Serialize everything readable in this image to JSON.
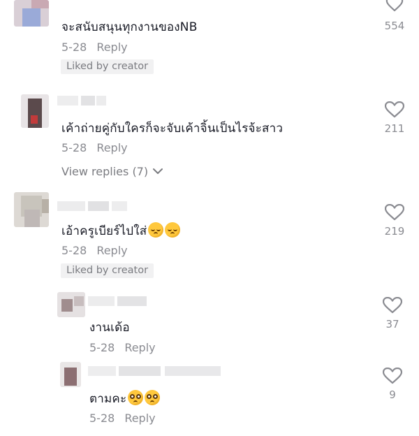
{
  "comments": [
    {
      "text": "จะสนับสนุนทุกงานของNB",
      "date": "5-28",
      "reply_label": "Reply",
      "liked_badge": "Liked by creator",
      "likes": "554"
    },
    {
      "text": "เค้าถ่ายคู่กับใครก็จะจับเค้าจิ้นเป็นไรจ้ะสาว",
      "date": "5-28",
      "reply_label": "Reply",
      "view_replies": "View replies (7)",
      "likes": "211"
    },
    {
      "text": "เอ้าครูเบียร์ไปใส่",
      "emojis": [
        "relieved-face-emoji",
        "relieved-face-emoji"
      ],
      "date": "5-28",
      "reply_label": "Reply",
      "liked_badge": "Liked by creator",
      "likes": "219"
    },
    {
      "text": "งานเด้อ",
      "date": "5-28",
      "reply_label": "Reply",
      "likes": "37"
    },
    {
      "text": "ตามคะ",
      "emojis": [
        "pleading-face-emoji",
        "pleading-face-emoji"
      ],
      "date": "5-28",
      "reply_label": "Reply",
      "likes": "9"
    }
  ],
  "icons": {
    "like": "heart-outline-icon",
    "chevron": "chevron-down-icon"
  },
  "colors": {
    "text": "#161823",
    "muted": "#8a8b91",
    "badge_bg": "#f1f1f2"
  }
}
